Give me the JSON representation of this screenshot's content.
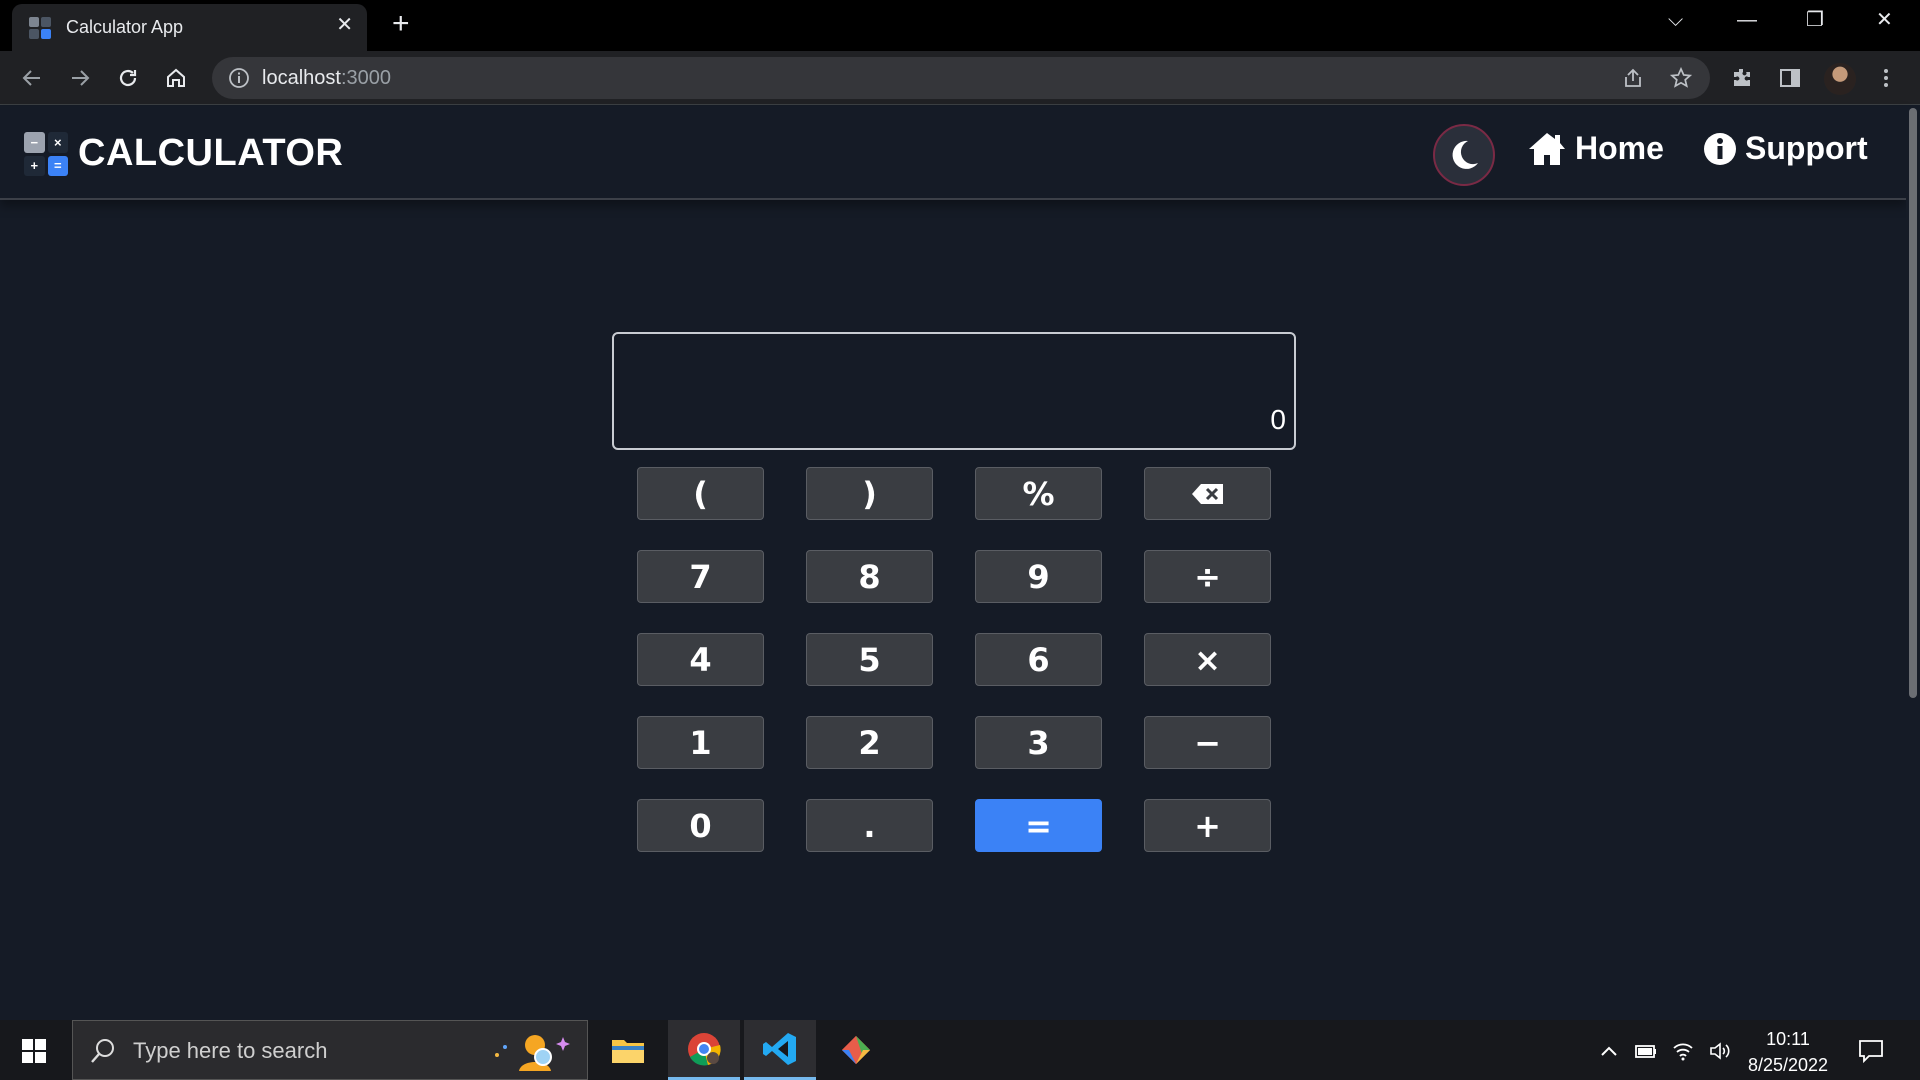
{
  "browser": {
    "tab_title": "Calculator App",
    "tab_close": "✕",
    "new_tab": "+",
    "url_host": "localhost",
    "url_port": ":3000",
    "window_controls": [
      "⌵",
      "—",
      "❐",
      "✕"
    ]
  },
  "header": {
    "logo_symbols": [
      "−",
      "×",
      "+",
      "="
    ],
    "title": "CALCULATOR",
    "theme_icon": "moon-icon",
    "nav": [
      {
        "label": "Home",
        "icon": "home-icon"
      },
      {
        "label": "Support",
        "icon": "info-icon"
      }
    ]
  },
  "calculator": {
    "display_value": "0",
    "keys": [
      {
        "label": "(",
        "name": "open-paren-key"
      },
      {
        "label": ")",
        "name": "close-paren-key"
      },
      {
        "label": "%",
        "name": "percent-key"
      },
      {
        "label": "",
        "name": "backspace-key",
        "icon": "backspace-icon"
      },
      {
        "label": "7",
        "name": "seven-key"
      },
      {
        "label": "8",
        "name": "eight-key"
      },
      {
        "label": "9",
        "name": "nine-key"
      },
      {
        "label": "÷",
        "name": "divide-key"
      },
      {
        "label": "4",
        "name": "four-key"
      },
      {
        "label": "5",
        "name": "five-key"
      },
      {
        "label": "6",
        "name": "six-key"
      },
      {
        "label": "×",
        "name": "multiply-key"
      },
      {
        "label": "1",
        "name": "one-key"
      },
      {
        "label": "2",
        "name": "two-key"
      },
      {
        "label": "3",
        "name": "three-key"
      },
      {
        "label": "−",
        "name": "subtract-key"
      },
      {
        "label": "0",
        "name": "zero-key"
      },
      {
        "label": ".",
        "name": "decimal-key"
      },
      {
        "label": "=",
        "name": "equals-key",
        "primary": true
      },
      {
        "label": "+",
        "name": "add-key"
      }
    ]
  },
  "taskbar": {
    "search_placeholder": "Type here to search",
    "time": "10:11",
    "date": "8/25/2022"
  },
  "colors": {
    "page_bg": "#151b26",
    "key_bg": "#3a3d42",
    "accent": "#3b82f6",
    "toggle_border": "#7a2a45"
  }
}
